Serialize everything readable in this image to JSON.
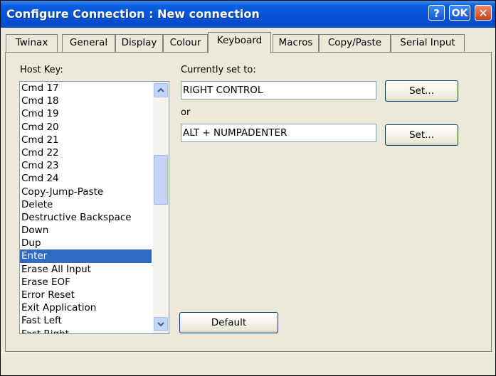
{
  "window": {
    "title": "Configure Connection : New connection",
    "help_label": "?",
    "ok_label": "OK",
    "close_label": "✕"
  },
  "tabs": [
    {
      "label": "Twinax"
    },
    {
      "label": "General"
    },
    {
      "label": "Display"
    },
    {
      "label": "Colour"
    },
    {
      "label": "Keyboard",
      "active": true
    },
    {
      "label": "Macros"
    },
    {
      "label": "Copy/Paste"
    },
    {
      "label": "Serial Input"
    }
  ],
  "host_key": {
    "label": "Host Key:",
    "items": [
      "Cmd 17",
      "Cmd 18",
      "Cmd 19",
      "Cmd 20",
      "Cmd 21",
      "Cmd 22",
      "Cmd 23",
      "Cmd 24",
      "Copy-Jump-Paste",
      "Delete",
      "Destructive Backspace",
      "Down",
      "Dup",
      "Enter",
      "Erase All Input",
      "Erase EOF",
      "Error Reset",
      "Exit Application",
      "Fast Left",
      "Fast Right"
    ],
    "selected": "Enter",
    "scroll_up_icon": "chevron-up-icon",
    "scroll_down_icon": "chevron-down-icon"
  },
  "mapping": {
    "currently_label": "Currently set to:",
    "primary_value": "RIGHT CONTROL",
    "or_label": "or",
    "secondary_value": "ALT + NUMPADENTER",
    "set_label": "Set...",
    "default_label": "Default"
  }
}
